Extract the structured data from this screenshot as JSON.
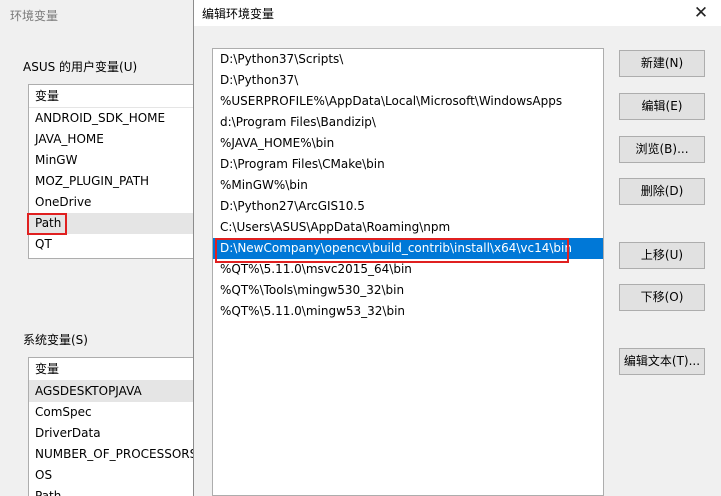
{
  "bg": {
    "title": "环境变量",
    "user_group_label": "ASUS 的用户变量(U)",
    "user_header": "变量",
    "user_vars": [
      "ANDROID_SDK_HOME",
      "JAVA_HOME",
      "MinGW",
      "MOZ_PLUGIN_PATH",
      "OneDrive",
      "Path",
      "QT"
    ],
    "sys_group_label": "系统变量(S)",
    "sys_header": "变量",
    "sys_vars": [
      "AGSDESKTOPJAVA",
      "ComSpec",
      "DriverData",
      "NUMBER_OF_PROCESSORS",
      "OS",
      "Path"
    ]
  },
  "dialog": {
    "title": "编辑环境变量",
    "close_glyph": "✕",
    "paths": [
      "D:\\Python37\\Scripts\\",
      "D:\\Python37\\",
      "%USERPROFILE%\\AppData\\Local\\Microsoft\\WindowsApps",
      "d:\\Program Files\\Bandizip\\",
      "%JAVA_HOME%\\bin",
      "D:\\Program Files\\CMake\\bin",
      "%MinGW%\\bin",
      "D:\\Python27\\ArcGIS10.5",
      "C:\\Users\\ASUS\\AppData\\Roaming\\npm",
      "D:\\NewCompany\\opencv\\build_contrib\\install\\x64\\vc14\\bin",
      "%QT%\\5.11.0\\msvc2015_64\\bin",
      "%QT%\\Tools\\mingw530_32\\bin",
      "%QT%\\5.11.0\\mingw53_32\\bin"
    ],
    "selected_index": 9,
    "buttons": {
      "new": "新建(N)",
      "edit": "编辑(E)",
      "browse": "浏览(B)...",
      "delete": "删除(D)",
      "up": "上移(U)",
      "down": "下移(O)",
      "edit_text": "编辑文本(T)..."
    }
  },
  "colors": {
    "selection": "#0078d7",
    "highlight_frame": "#e02020"
  }
}
